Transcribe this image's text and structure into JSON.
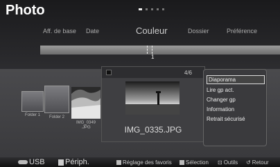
{
  "header": {
    "title": "Photo"
  },
  "pager": {
    "count": 5,
    "active_index": 0
  },
  "tabs": [
    {
      "label": "Aff. de base",
      "size": "small"
    },
    {
      "label": "Date",
      "size": "small"
    },
    {
      "label": "Couleur",
      "size": "big"
    },
    {
      "label": "Dossier",
      "size": "small"
    },
    {
      "label": "Préférence",
      "size": "small"
    }
  ],
  "timeline": {
    "label": "1",
    "marker": "1 1"
  },
  "folders": [
    {
      "label": "Folder 1"
    },
    {
      "label": "Folder 2"
    },
    {
      "label": "IMG_0349\n.JPG"
    }
  ],
  "card": {
    "counter": "4/6",
    "filename": "IMG_0335.JPG"
  },
  "menu": {
    "items": [
      {
        "label": "Diaporama",
        "selected": true
      },
      {
        "label": "Lire gp act.",
        "selected": false
      },
      {
        "label": "Changer gp",
        "selected": false
      },
      {
        "label": "Information",
        "selected": false
      },
      {
        "label": "Retrait sécurisé",
        "selected": false
      }
    ]
  },
  "bottom_bar": {
    "usb": "USB",
    "periph": "Périph.",
    "favorites": "Réglage des favoris",
    "selection": "Sélection",
    "tools": "Outils",
    "back": "Retour"
  }
}
